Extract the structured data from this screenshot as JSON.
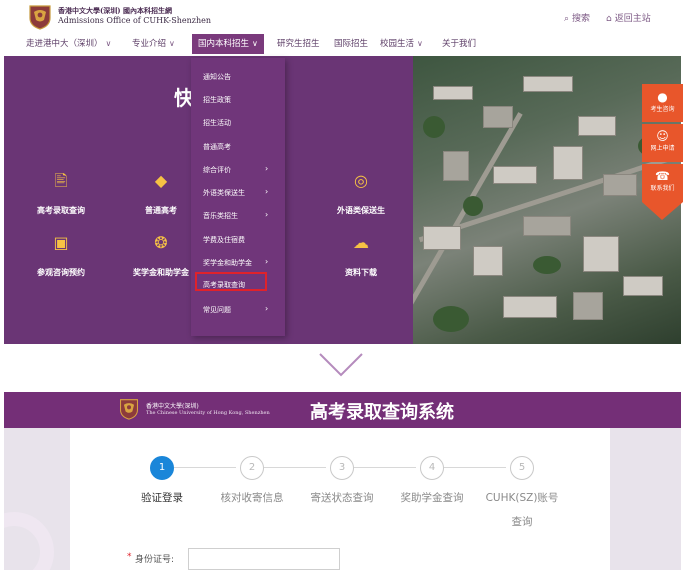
{
  "header": {
    "logo_text_1": "香港中文大學(深圳) 國內本科招生網",
    "logo_text_2": "Admissions Office of CUHK-Shenzhen",
    "search_label": "搜索",
    "home_label": "返回主站"
  },
  "nav": {
    "items": [
      {
        "label": "走进港中大（深圳）"
      },
      {
        "label": "专业介绍"
      },
      {
        "label": "国内本科招生"
      },
      {
        "label": "研究生招生"
      },
      {
        "label": "国际招生"
      },
      {
        "label": "校园生活"
      },
      {
        "label": "关于我们"
      }
    ]
  },
  "hero": {
    "quick_title": "快",
    "quick_items": [
      {
        "label": "高考录取查询",
        "icon": "document-icon"
      },
      {
        "label": "普通高考",
        "icon": "tag-icon"
      },
      {
        "label": "外语类保送生",
        "icon": "globe-icon"
      },
      {
        "label": "参观咨询预约",
        "icon": "calendar-icon"
      },
      {
        "label": "奖学金和助学金",
        "icon": "medal-icon"
      },
      {
        "label": "资料下载",
        "icon": "cloud-download-icon"
      }
    ]
  },
  "dropdown": {
    "items": [
      {
        "label": "通知公告",
        "has_sub": false
      },
      {
        "label": "招生政策",
        "has_sub": false
      },
      {
        "label": "招生活动",
        "has_sub": false
      },
      {
        "label": "普通高考",
        "has_sub": false
      },
      {
        "label": "综合评价",
        "has_sub": true
      },
      {
        "label": "外语类保送生",
        "has_sub": true
      },
      {
        "label": "音乐类招生",
        "has_sub": true
      },
      {
        "label": "学费及住宿费",
        "has_sub": false
      },
      {
        "label": "奖学金和助学金",
        "has_sub": true
      },
      {
        "label": "高考录取查询",
        "has_sub": false,
        "highlighted": true
      },
      {
        "label": "常见问题",
        "has_sub": true
      }
    ]
  },
  "side": {
    "consult": "考生咨询",
    "apply": "网上申请",
    "contact": "联系我们"
  },
  "query_system": {
    "logo_text_1": "香港中文大學(深圳)",
    "logo_text_2": "The Chinese University of Hong Kong, Shenzhen",
    "title": "高考录取查询系统",
    "steps": [
      {
        "num": "1",
        "label": "验证登录",
        "active": true
      },
      {
        "num": "2",
        "label": "核对收寄信息",
        "active": false
      },
      {
        "num": "3",
        "label": "寄送状态查询",
        "active": false
      },
      {
        "num": "4",
        "label": "奖助学金查询",
        "active": false
      },
      {
        "num": "5",
        "label": "CUHK(SZ)账号",
        "label2": "查询",
        "active": false
      }
    ],
    "id_required_mark": "*",
    "id_label": "身份证号:",
    "id_value": ""
  },
  "colors": {
    "brand_purple": "#742f77",
    "step_active": "#1a86d9",
    "highlight_red": "#e0222b",
    "icon_gold": "#f6c244",
    "side_orange": "#e8562b"
  }
}
